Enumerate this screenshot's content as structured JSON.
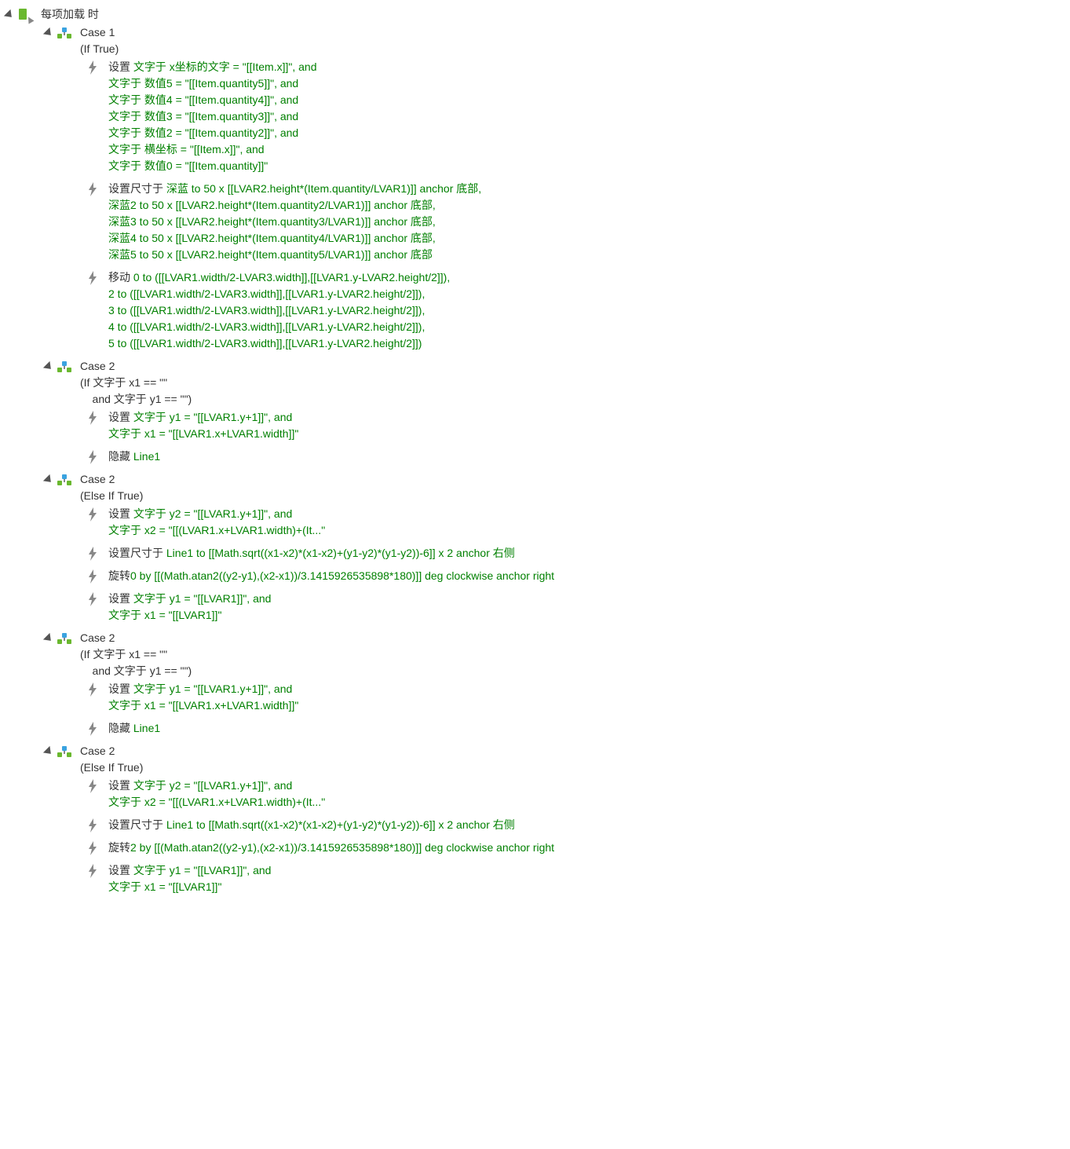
{
  "event": {
    "title": "每项加载 时"
  },
  "cases": [
    {
      "title": "Case 1",
      "condition": "(If True)",
      "actions": [
        {
          "lines": [
            {
              "p": "设置 ",
              "g": "文字于 x坐标的文字 = \"[[Item.x]]\", and"
            },
            {
              "p": "",
              "g": "文字于 数值5 = \"[[Item.quantity5]]\", and"
            },
            {
              "p": "",
              "g": "文字于 数值4 = \"[[Item.quantity4]]\", and"
            },
            {
              "p": "",
              "g": "文字于 数值3 = \"[[Item.quantity3]]\", and"
            },
            {
              "p": "",
              "g": "文字于 数值2 = \"[[Item.quantity2]]\", and"
            },
            {
              "p": "",
              "g": "文字于 横坐标 = \"[[Item.x]]\", and"
            },
            {
              "p": "",
              "g": "文字于 数值0 = \"[[Item.quantity]]\""
            }
          ]
        },
        {
          "lines": [
            {
              "p": "设置尺寸于 ",
              "g": "深蓝 to 50 x [[LVAR2.height*(Item.quantity/LVAR1)]] anchor 底部,"
            },
            {
              "p": "",
              "g": "深蓝2 to 50 x [[LVAR2.height*(Item.quantity2/LVAR1)]] anchor 底部,"
            },
            {
              "p": "",
              "g": "深蓝3 to 50 x [[LVAR2.height*(Item.quantity3/LVAR1)]] anchor 底部,"
            },
            {
              "p": "",
              "g": "深蓝4 to 50 x [[LVAR2.height*(Item.quantity4/LVAR1)]] anchor 底部,"
            },
            {
              "p": "",
              "g": "深蓝5 to 50 x [[LVAR2.height*(Item.quantity5/LVAR1)]] anchor 底部"
            }
          ]
        },
        {
          "lines": [
            {
              "p": "移动 ",
              "g": "0 to ([[LVAR1.width/2-LVAR3.width]],[[LVAR1.y-LVAR2.height/2]]),"
            },
            {
              "p": "",
              "g": "2 to ([[LVAR1.width/2-LVAR3.width]],[[LVAR1.y-LVAR2.height/2]]),"
            },
            {
              "p": "",
              "g": "3 to ([[LVAR1.width/2-LVAR3.width]],[[LVAR1.y-LVAR2.height/2]]),"
            },
            {
              "p": "",
              "g": "4 to ([[LVAR1.width/2-LVAR3.width]],[[LVAR1.y-LVAR2.height/2]]),"
            },
            {
              "p": "",
              "g": "5 to ([[LVAR1.width/2-LVAR3.width]],[[LVAR1.y-LVAR2.height/2]])"
            }
          ]
        }
      ]
    },
    {
      "title": "Case 2",
      "condition": "(If 文字于 x1 == \"\"\n    and 文字于 y1 == \"\")",
      "actions": [
        {
          "lines": [
            {
              "p": "设置 ",
              "g": "文字于 y1 = \"[[LVAR1.y+1]]\", and"
            },
            {
              "p": "",
              "g": "文字于 x1 = \"[[LVAR1.x+LVAR1.width]]\""
            }
          ]
        },
        {
          "lines": [
            {
              "p": "隐藏 ",
              "g": "Line1"
            }
          ]
        }
      ]
    },
    {
      "title": "Case 2",
      "condition": "(Else If True)",
      "actions": [
        {
          "lines": [
            {
              "p": "设置 ",
              "g": "文字于 y2 = \"[[LVAR1.y+1]]\", and"
            },
            {
              "p": "",
              "g": "文字于 x2 = \"[[(LVAR1.x+LVAR1.width)+(It...\""
            }
          ]
        },
        {
          "lines": [
            {
              "p": "设置尺寸于 ",
              "g": "Line1 to [[Math.sqrt((x1-x2)*(x1-x2)+(y1-y2)*(y1-y2))-6]] x 2 anchor 右侧"
            }
          ]
        },
        {
          "lines": [
            {
              "p": "旋转",
              "g": "0 by [[(Math.atan2((y2-y1),(x2-x1))/3.1415926535898*180)]] deg clockwise anchor right"
            }
          ]
        },
        {
          "lines": [
            {
              "p": "设置 ",
              "g": "文字于 y1 = \"[[LVAR1]]\", and"
            },
            {
              "p": "",
              "g": "文字于 x1 = \"[[LVAR1]]\""
            }
          ]
        }
      ]
    },
    {
      "title": "Case 2",
      "condition": "(If 文字于 x1 == \"\"\n    and 文字于 y1 == \"\")",
      "actions": [
        {
          "lines": [
            {
              "p": "设置 ",
              "g": "文字于 y1 = \"[[LVAR1.y+1]]\", and"
            },
            {
              "p": "",
              "g": "文字于 x1 = \"[[LVAR1.x+LVAR1.width]]\""
            }
          ]
        },
        {
          "lines": [
            {
              "p": "隐藏 ",
              "g": "Line1"
            }
          ]
        }
      ]
    },
    {
      "title": "Case 2",
      "condition": "(Else If True)",
      "actions": [
        {
          "lines": [
            {
              "p": "设置 ",
              "g": "文字于 y2 = \"[[LVAR1.y+1]]\", and"
            },
            {
              "p": "",
              "g": "文字于 x2 = \"[[(LVAR1.x+LVAR1.width)+(It...\""
            }
          ]
        },
        {
          "lines": [
            {
              "p": "设置尺寸于 ",
              "g": "Line1 to [[Math.sqrt((x1-x2)*(x1-x2)+(y1-y2)*(y1-y2))-6]] x 2 anchor 右侧"
            }
          ]
        },
        {
          "lines": [
            {
              "p": "旋转",
              "g": "2 by [[(Math.atan2((y2-y1),(x2-x1))/3.1415926535898*180)]] deg clockwise anchor right"
            }
          ]
        },
        {
          "lines": [
            {
              "p": "设置 ",
              "g": "文字于 y1 = \"[[LVAR1]]\", and"
            },
            {
              "p": "",
              "g": "文字于 x1 = \"[[LVAR1]]\""
            }
          ]
        }
      ]
    }
  ]
}
